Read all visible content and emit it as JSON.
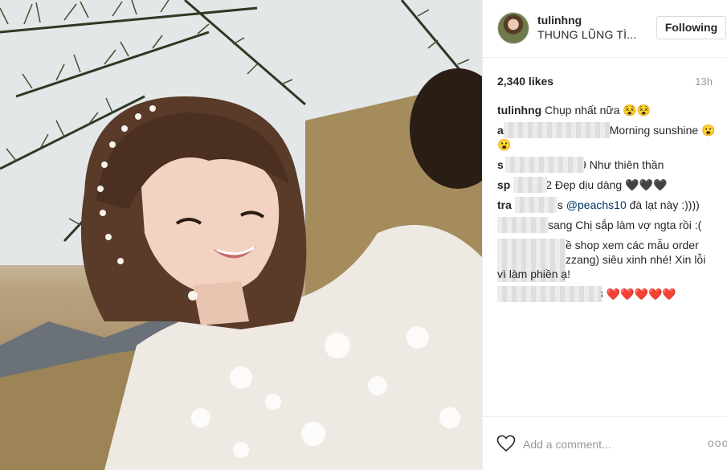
{
  "post": {
    "image_alt": "Selfie of a smiling woman in a white lace dress under pine branches",
    "username": "tulinhng",
    "location": "THUNG LŨNG TÌ...",
    "follow_label": "Following",
    "likes": "2,340 likes",
    "time": "13h"
  },
  "comments": [
    {
      "user": "tulinhng",
      "text": "Chụp nhất nữa 😵😵"
    },
    {
      "user": "a",
      "text": "Morning sunshine 😮😮"
    },
    {
      "user": "s",
      "text": "4799  Như thiên thần"
    },
    {
      "user": "sp",
      "text": "2 Đẹp dịu dàng 🖤🖤🖤"
    },
    {
      "user": "tra",
      "text_before": "is ",
      "mention": "@peachs10",
      "text_after": " đà lạt này :))))"
    },
    {
      "user": "",
      "text": "sang Chị sắp làm vợ ngta rồi :("
    },
    {
      "user": "",
      "text": "ề shop xem các mẫu order"
    },
    {
      "user": "",
      "text": "zzang) siêu xinh nhé! Xin lỗi"
    },
    {
      "user": "",
      "text": "vì làm phiền ạ!"
    },
    {
      "user": "",
      "text": "3 ❤️❤️❤️❤️❤️"
    }
  ],
  "comment_box": {
    "placeholder": "Add a comment...",
    "more_label": "ooo"
  },
  "icons": {
    "like": "heart-outline-icon",
    "more": "more-options-icon"
  }
}
